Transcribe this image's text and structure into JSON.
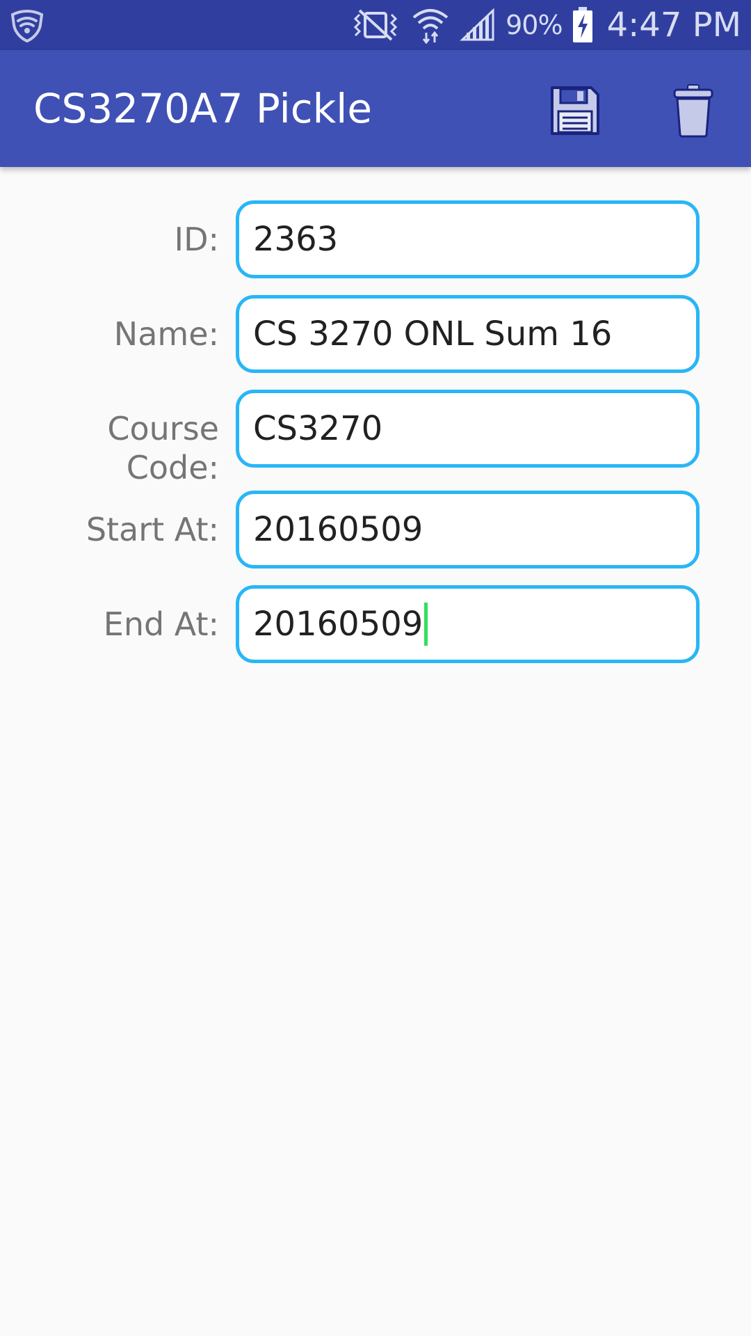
{
  "status_bar": {
    "battery_percent": "90%",
    "time": "4:47 PM",
    "icons": [
      "shield-icon",
      "vibrate-icon",
      "wifi-icon",
      "signal-icon",
      "battery-charging-icon"
    ]
  },
  "app_bar": {
    "title": "CS3270A7 Pickle",
    "actions": [
      "save-icon",
      "delete-icon"
    ],
    "color": "#3f51b5"
  },
  "form": {
    "id": {
      "label": "ID:",
      "value": "2363"
    },
    "name": {
      "label": "Name:",
      "value": "CS 3270 ONL Sum 16"
    },
    "course_code": {
      "label_line1": "Course",
      "label_line2": "Code:",
      "value": "CS3270"
    },
    "start_at": {
      "label": "Start At:",
      "value": "20160509"
    },
    "end_at": {
      "label": "End At:",
      "value": "20160509"
    }
  },
  "colors": {
    "status_bar": "#303f9f",
    "input_border": "#29b6f6",
    "cursor": "#33e05a",
    "label_text": "#757575"
  }
}
